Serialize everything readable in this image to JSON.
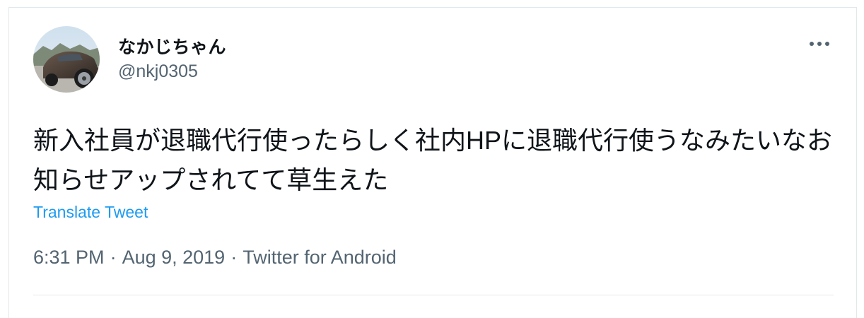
{
  "tweet": {
    "author": {
      "display_name": "なかじちゃん",
      "handle": "@nkj0305"
    },
    "text": "新入社員が退職代行使ったらしく社内HPに退職代行使うなみたいなお知らせアップされてて草生えた",
    "translate_label": "Translate Tweet",
    "meta": {
      "time": "6:31 PM",
      "separator": "·",
      "date": "Aug 9, 2019",
      "source": "Twitter for Android"
    },
    "more_icon": "more-horizontal-icon"
  },
  "colors": {
    "text_primary": "#0f1419",
    "text_secondary": "#536471",
    "link": "#1d9bf0",
    "border": "#e1e8ed"
  }
}
